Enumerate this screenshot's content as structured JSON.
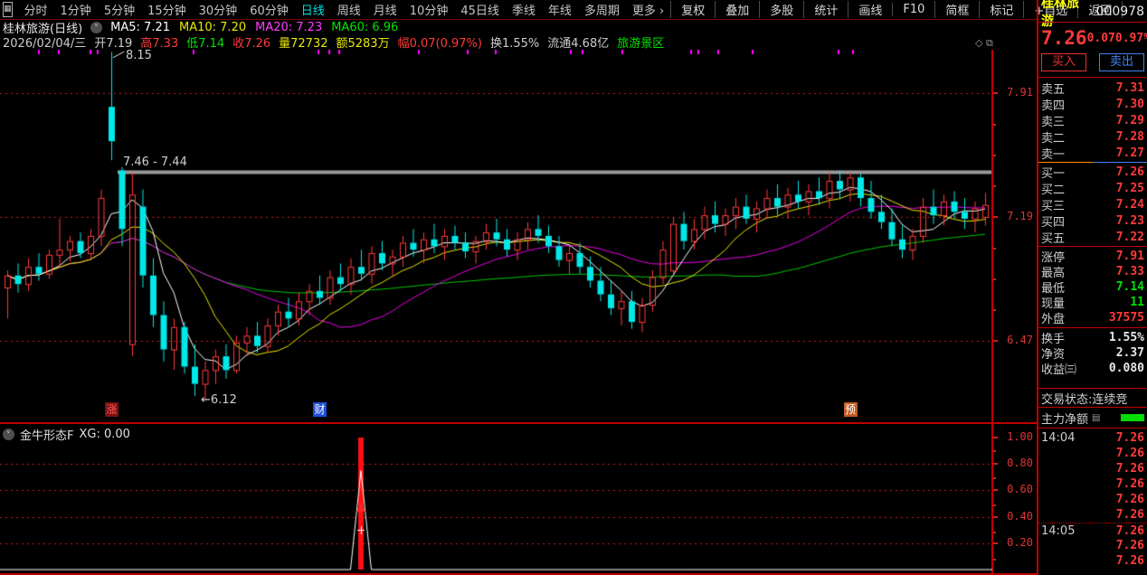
{
  "topbar": {
    "periods": [
      "分时",
      "1分钟",
      "5分钟",
      "15分钟",
      "30分钟",
      "60分钟",
      "日线",
      "周线",
      "月线",
      "10分钟",
      "45日线",
      "季线",
      "年线",
      "多周期",
      "更多 ›"
    ],
    "active": "日线",
    "tools": [
      "复权",
      "叠加",
      "多股",
      "统计",
      "画线",
      "F10",
      "简框",
      "标记",
      "+自选",
      "返回"
    ]
  },
  "info_line1": {
    "title": "桂林旅游(日线)",
    "mas": [
      {
        "text": "MA5: 7.21",
        "color": "#ffffff"
      },
      {
        "text": "MA10: 7.20",
        "color": "#e8e800"
      },
      {
        "text": "MA20: 7.23",
        "color": "#ff3cff"
      },
      {
        "text": "MA60: 6.96",
        "color": "#00e400"
      }
    ]
  },
  "info_line2": {
    "items": [
      {
        "text": "2026/02/04/三",
        "color": "#cccccc"
      },
      {
        "text": "开7.19",
        "color": "#cccccc"
      },
      {
        "text": "高7.33",
        "color": "#ff3a3a"
      },
      {
        "text": "低7.14",
        "color": "#00e400"
      },
      {
        "text": "收7.26",
        "color": "#ff3a3a"
      },
      {
        "text": "量72732",
        "color": "#e8e800"
      },
      {
        "text": "额5283万",
        "color": "#e8e800"
      },
      {
        "text": "幅0.07(0.97%)",
        "color": "#ff3a3a"
      },
      {
        "text": "换1.55%",
        "color": "#cccccc"
      },
      {
        "text": "流通4.68亿",
        "color": "#cccccc"
      },
      {
        "text": "旅游景区",
        "color": "#00e400"
      }
    ]
  },
  "colors": {
    "up": "#ff3a3a",
    "down": "#00e8e8",
    "ma5": "#ffffff",
    "ma10": "#e8e800",
    "ma20": "#e800e8",
    "ma60": "#00c800",
    "grid": "#cc2020",
    "border": "#c00000",
    "gray_line": "#9a9a9a",
    "active_tab": "#00e0e0",
    "magenta_tick": "#ff00ff"
  },
  "chart_data": {
    "type": "candlestick+indicator",
    "main": {
      "title": "桂林旅游(日线)",
      "y_axis_ticks": [
        7.91,
        7.19,
        6.47
      ],
      "price_range": [
        6.06,
        8.17
      ],
      "peak_label": "8.15",
      "gap_line_price": 7.45,
      "gap_line_label": "7.46 - 7.44",
      "low_label": "←6.12",
      "limit_up_dotted_price": 7.91,
      "ma_periods": [
        5,
        10,
        20,
        60
      ],
      "top_ruler_ticks_x": [
        42,
        64,
        99,
        107,
        213,
        351,
        363,
        374,
        462,
        516,
        547,
        630,
        643,
        687,
        763,
        771,
        793,
        831,
        926,
        942
      ],
      "event_markers": [
        {
          "day": 10,
          "char": "涨",
          "bg": "#7a1212",
          "fg": "#ff5a5a"
        },
        {
          "day": 30,
          "char": "财",
          "bg": "#1f4fd8",
          "fg": "#ffffff"
        },
        {
          "day": 81,
          "char": "预",
          "bg": "#c05a1e",
          "fg": "#ffffff"
        }
      ],
      "candles_ohlc": [
        [
          6.78,
          6.88,
          6.6,
          6.85
        ],
        [
          6.85,
          6.92,
          6.75,
          6.8
        ],
        [
          6.8,
          6.95,
          6.76,
          6.9
        ],
        [
          6.9,
          6.98,
          6.82,
          6.86
        ],
        [
          6.86,
          7.0,
          6.83,
          6.97
        ],
        [
          6.97,
          7.18,
          6.9,
          7.0
        ],
        [
          7.0,
          7.08,
          6.93,
          7.05
        ],
        [
          7.05,
          7.1,
          6.95,
          6.98
        ],
        [
          6.98,
          7.12,
          6.94,
          7.08
        ],
        [
          7.08,
          7.35,
          7.02,
          7.3
        ],
        [
          7.83,
          8.15,
          7.52,
          7.63
        ],
        [
          7.46,
          7.48,
          7.02,
          7.12
        ],
        [
          6.45,
          7.45,
          6.38,
          7.32
        ],
        [
          7.25,
          7.35,
          6.78,
          6.85
        ],
        [
          6.85,
          6.95,
          6.55,
          6.62
        ],
        [
          6.62,
          6.7,
          6.35,
          6.42
        ],
        [
          6.42,
          6.6,
          6.3,
          6.55
        ],
        [
          6.55,
          6.58,
          6.28,
          6.32
        ],
        [
          6.32,
          6.45,
          6.15,
          6.22
        ],
        [
          6.22,
          6.35,
          6.12,
          6.3
        ],
        [
          6.3,
          6.42,
          6.22,
          6.38
        ],
        [
          6.38,
          6.45,
          6.25,
          6.3
        ],
        [
          6.3,
          6.5,
          6.28,
          6.46
        ],
        [
          6.46,
          6.55,
          6.38,
          6.5
        ],
        [
          6.5,
          6.58,
          6.4,
          6.44
        ],
        [
          6.44,
          6.6,
          6.4,
          6.56
        ],
        [
          6.56,
          6.68,
          6.5,
          6.64
        ],
        [
          6.64,
          6.72,
          6.55,
          6.6
        ],
        [
          6.6,
          6.75,
          6.56,
          6.7
        ],
        [
          6.7,
          6.8,
          6.62,
          6.76
        ],
        [
          6.76,
          6.85,
          6.68,
          6.72
        ],
        [
          6.72,
          6.88,
          6.68,
          6.84
        ],
        [
          6.84,
          6.92,
          6.76,
          6.8
        ],
        [
          6.8,
          6.95,
          6.74,
          6.9
        ],
        [
          6.9,
          7.0,
          6.82,
          6.86
        ],
        [
          6.86,
          7.02,
          6.8,
          6.98
        ],
        [
          6.98,
          7.05,
          6.88,
          6.92
        ],
        [
          6.92,
          7.0,
          6.84,
          6.96
        ],
        [
          6.96,
          7.08,
          6.9,
          7.04
        ],
        [
          7.04,
          7.12,
          6.96,
          7.0
        ],
        [
          7.0,
          7.1,
          6.92,
          7.06
        ],
        [
          7.06,
          7.15,
          6.98,
          7.02
        ],
        [
          7.02,
          7.12,
          6.94,
          7.08
        ],
        [
          7.08,
          7.14,
          7.0,
          7.04
        ],
        [
          7.04,
          7.1,
          6.95,
          6.99
        ],
        [
          6.99,
          7.08,
          6.92,
          7.05
        ],
        [
          7.05,
          7.15,
          7.0,
          7.1
        ],
        [
          7.1,
          7.18,
          7.02,
          7.06
        ],
        [
          7.06,
          7.12,
          6.96,
          7.0
        ],
        [
          7.0,
          7.1,
          6.94,
          7.06
        ],
        [
          7.06,
          7.16,
          7.0,
          7.12
        ],
        [
          7.12,
          7.2,
          7.04,
          7.08
        ],
        [
          7.08,
          7.14,
          6.98,
          7.02
        ],
        [
          7.02,
          7.08,
          6.9,
          6.94
        ],
        [
          6.94,
          7.02,
          6.86,
          6.98
        ],
        [
          6.98,
          7.04,
          6.86,
          6.9
        ],
        [
          6.9,
          6.96,
          6.78,
          6.82
        ],
        [
          6.82,
          6.9,
          6.7,
          6.74
        ],
        [
          6.74,
          6.82,
          6.62,
          6.66
        ],
        [
          6.66,
          6.76,
          6.56,
          6.7
        ],
        [
          6.7,
          6.76,
          6.54,
          6.58
        ],
        [
          6.58,
          6.72,
          6.52,
          6.68
        ],
        [
          6.68,
          6.88,
          6.64,
          6.84
        ],
        [
          6.84,
          7.05,
          6.8,
          7.0
        ],
        [
          6.88,
          7.19,
          6.86,
          7.15
        ],
        [
          7.15,
          7.22,
          7.0,
          7.05
        ],
        [
          7.05,
          7.18,
          7.0,
          7.12
        ],
        [
          7.12,
          7.25,
          7.06,
          7.2
        ],
        [
          7.2,
          7.28,
          7.1,
          7.15
        ],
        [
          7.15,
          7.24,
          7.08,
          7.2
        ],
        [
          7.2,
          7.3,
          7.12,
          7.25
        ],
        [
          7.25,
          7.32,
          7.15,
          7.18
        ],
        [
          7.18,
          7.28,
          7.1,
          7.24
        ],
        [
          7.24,
          7.35,
          7.18,
          7.3
        ],
        [
          7.3,
          7.38,
          7.2,
          7.25
        ],
        [
          7.25,
          7.36,
          7.18,
          7.32
        ],
        [
          7.32,
          7.4,
          7.24,
          7.28
        ],
        [
          7.28,
          7.38,
          7.2,
          7.34
        ],
        [
          7.34,
          7.42,
          7.26,
          7.3
        ],
        [
          7.3,
          7.45,
          7.24,
          7.4
        ],
        [
          7.4,
          7.46,
          7.3,
          7.35
        ],
        [
          7.35,
          7.45,
          7.28,
          7.42
        ],
        [
          7.42,
          7.44,
          7.25,
          7.3
        ],
        [
          7.3,
          7.4,
          7.18,
          7.22
        ],
        [
          7.22,
          7.32,
          7.12,
          7.16
        ],
        [
          7.16,
          7.24,
          7.02,
          7.06
        ],
        [
          7.06,
          7.14,
          6.95,
          7.0
        ],
        [
          7.0,
          7.12,
          6.94,
          7.08
        ],
        [
          7.08,
          7.3,
          7.04,
          7.25
        ],
        [
          7.25,
          7.35,
          7.15,
          7.2
        ],
        [
          7.2,
          7.32,
          7.14,
          7.28
        ],
        [
          7.28,
          7.34,
          7.18,
          7.22
        ],
        [
          7.22,
          7.3,
          7.12,
          7.18
        ],
        [
          7.18,
          7.28,
          7.1,
          7.24
        ],
        [
          7.19,
          7.33,
          7.14,
          7.26
        ]
      ]
    },
    "indicator": {
      "name": "金牛形态F",
      "label": "XG: 0.00",
      "y_axis_ticks": [
        1.0,
        0.8,
        0.6,
        0.4,
        0.2
      ],
      "value_range": [
        0,
        1.1
      ],
      "xg_default": 0,
      "xg_points": [
        {
          "day": 34,
          "value": 0.75
        }
      ],
      "signal_bars": [
        {
          "day": 34,
          "value": 1.0
        }
      ],
      "signal_markers": [
        {
          "day": 34,
          "type": "up-arrow",
          "color": "#ff2020"
        },
        {
          "day": 34,
          "type": "plus",
          "color": "#ffffff"
        }
      ]
    }
  },
  "right_panel": {
    "stock_name": "桂林旅游",
    "stock_code": "000978",
    "price": "7.26",
    "change": "0.07",
    "change_pct": "0.97%",
    "buy_button": "买入",
    "sell_button": "卖出",
    "sell_levels": [
      {
        "label": "卖五",
        "price": "7.31"
      },
      {
        "label": "卖四",
        "price": "7.30"
      },
      {
        "label": "卖三",
        "price": "7.29"
      },
      {
        "label": "卖二",
        "price": "7.28"
      },
      {
        "label": "卖一",
        "price": "7.27"
      }
    ],
    "buy_levels": [
      {
        "label": "买一",
        "price": "7.26"
      },
      {
        "label": "买二",
        "price": "7.25"
      },
      {
        "label": "买三",
        "price": "7.24"
      },
      {
        "label": "买四",
        "price": "7.23"
      },
      {
        "label": "买五",
        "price": "7.22"
      }
    ],
    "stats": [
      {
        "label": "涨停",
        "value": "7.91",
        "color": "#ff3a3a"
      },
      {
        "label": "最高",
        "value": "7.33",
        "color": "#ff3a3a"
      },
      {
        "label": "最低",
        "value": "7.14",
        "color": "#00e400"
      },
      {
        "label": "现量",
        "value": "11",
        "color": "#00e400"
      },
      {
        "label": "外盘",
        "value": "37575",
        "color": "#ff3a3a"
      }
    ],
    "stats2": [
      {
        "label": "换手",
        "value": "1.55%",
        "color": "#e8e8e8"
      },
      {
        "label": "净资",
        "value": "2.37",
        "color": "#e8e8e8"
      },
      {
        "label": "收益㈢",
        "value": "0.080",
        "color": "#e8e8e8"
      }
    ],
    "trade_status": "交易状态:连续竞",
    "main_net_label": "主力净额",
    "main_net_bar_color": "#00dc00",
    "ticks": [
      {
        "time": "14:04",
        "price": "7.26",
        "group_start": false
      },
      {
        "time": "",
        "price": "7.26",
        "group_start": false
      },
      {
        "time": "",
        "price": "7.26",
        "group_start": false
      },
      {
        "time": "",
        "price": "7.26",
        "group_start": false
      },
      {
        "time": "",
        "price": "7.26",
        "group_start": false
      },
      {
        "time": "",
        "price": "7.26",
        "group_start": false
      },
      {
        "time": "14:05",
        "price": "7.26",
        "group_start": true
      },
      {
        "time": "",
        "price": "7.26",
        "group_start": false
      },
      {
        "time": "",
        "price": "7.26",
        "group_start": false
      }
    ]
  }
}
